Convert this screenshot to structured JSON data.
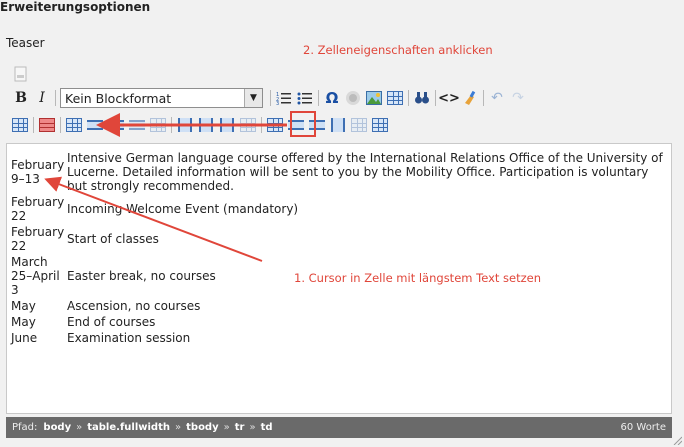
{
  "section_title": "Erweiterungsoptionen",
  "field_label": "Teaser",
  "annotations": {
    "step2": "2. Zelleneigenschaften anklicken",
    "step1": "1. Cursor in Zelle mit längstem Text setzen"
  },
  "toolbar": {
    "bold": "B",
    "italic": "I",
    "block_format": "Kein Blockformat",
    "omega": "Ω"
  },
  "table_rows": [
    {
      "date": "February 9–13",
      "desc": "Intensive German language course offered by the International Relations Office of the University of Lucerne. Detailed information will be sent to you by the Mobility Office. Participation is voluntary but strongly recommended."
    },
    {
      "date": "February 22",
      "desc": "Incoming Welcome Event (mandatory)"
    },
    {
      "date": "February 22",
      "desc": "Start of classes"
    },
    {
      "date": "March 25–April 3",
      "desc": "Easter break, no courses"
    },
    {
      "date": "May",
      "desc": "Ascension, no courses"
    },
    {
      "date": "May",
      "desc": "End of courses"
    },
    {
      "date": "June",
      "desc": "Examination session"
    }
  ],
  "pathbar": {
    "label": "Pfad:",
    "crumbs": [
      "body",
      "table.fullwidth",
      "tbody",
      "tr",
      "td"
    ],
    "word_count": "60 Worte"
  },
  "colors": {
    "annotation": "#e0463a",
    "pathbar_bg": "#6a6a6a",
    "icon_blue": "#3e6fb3"
  }
}
